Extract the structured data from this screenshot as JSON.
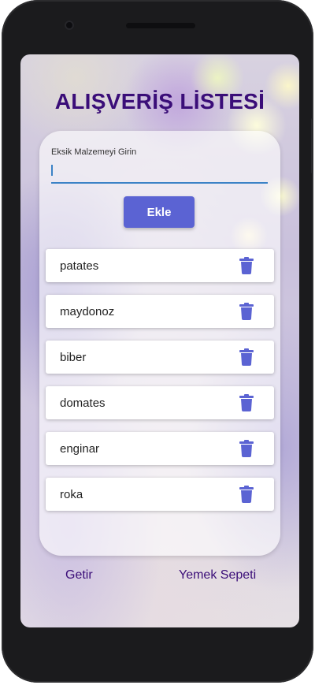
{
  "title": "ALIŞVERİŞ LİSTESİ",
  "input": {
    "label": "Eksik Malzemeyi Girin",
    "value": "",
    "placeholder": ""
  },
  "add_button": {
    "label": "Ekle"
  },
  "items": [
    {
      "label": "patates",
      "icon": "trash-icon"
    },
    {
      "label": "maydonoz",
      "icon": "trash-icon"
    },
    {
      "label": "biber",
      "icon": "trash-icon"
    },
    {
      "label": "domates",
      "icon": "trash-icon"
    },
    {
      "label": "enginar",
      "icon": "trash-icon"
    },
    {
      "label": "roka",
      "icon": "trash-icon"
    }
  ],
  "bottom": {
    "left_label": "Getir",
    "right_label": "Yemek Sepeti"
  },
  "colors": {
    "title": "#3a0d78",
    "accent": "#5b63d3",
    "input_underline": "#3b82c6"
  }
}
